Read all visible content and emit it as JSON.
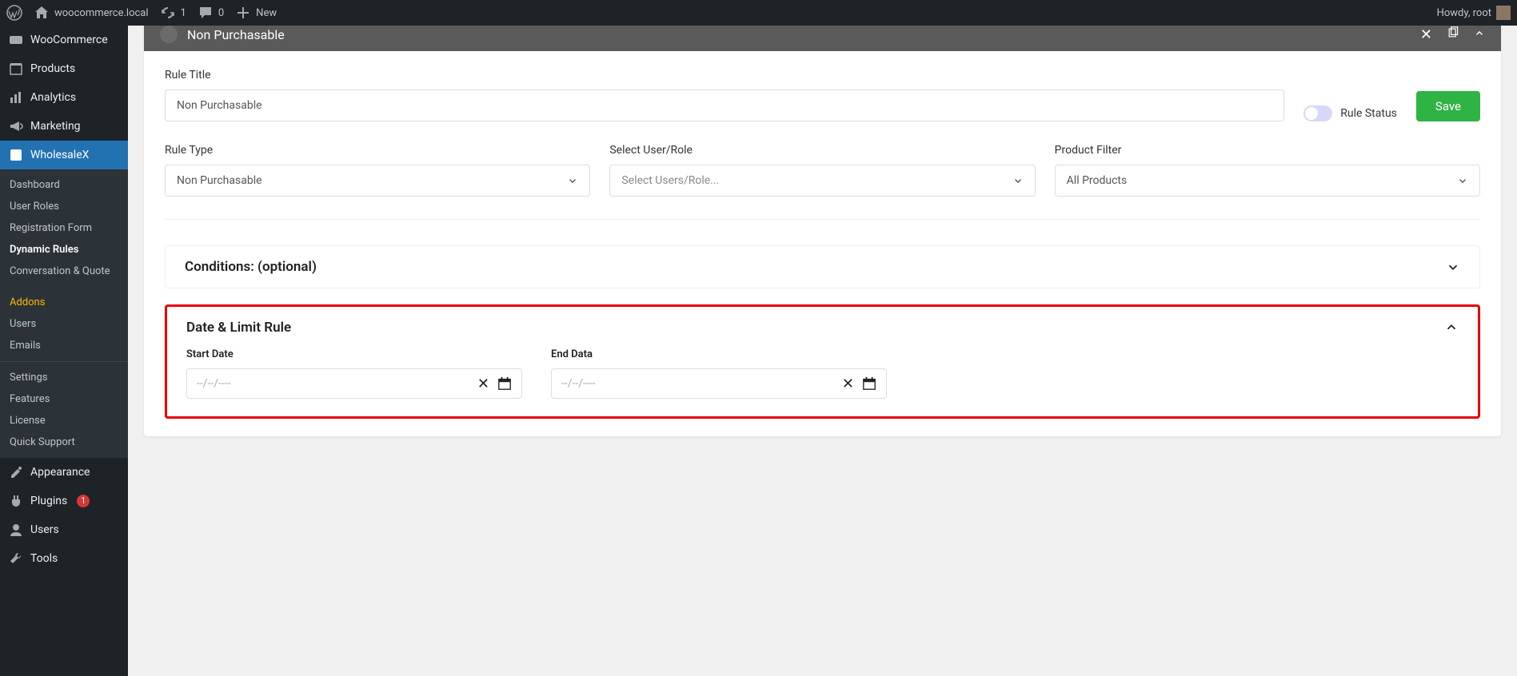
{
  "topbar": {
    "site_name": "woocommerce.local",
    "updates_count": "1",
    "comments_count": "0",
    "new_label": "New",
    "howdy": "Howdy, root"
  },
  "sidebar": {
    "woocommerce": "WooCommerce",
    "products": "Products",
    "analytics": "Analytics",
    "marketing": "Marketing",
    "wholesalex": "WholesaleX",
    "sub": {
      "dashboard": "Dashboard",
      "user_roles": "User Roles",
      "registration_form": "Registration Form",
      "dynamic_rules": "Dynamic Rules",
      "conversation_quote": "Conversation & Quote",
      "addons": "Addons",
      "users": "Users",
      "emails": "Emails",
      "settings": "Settings",
      "features": "Features",
      "license": "License",
      "quick_support": "Quick Support"
    },
    "appearance": "Appearance",
    "plugins": "Plugins",
    "plugins_badge": "1",
    "users_main": "Users",
    "tools": "Tools"
  },
  "panel": {
    "header_title": "Non Purchasable",
    "rule_title_label": "Rule Title",
    "rule_title_value": "Non Purchasable",
    "rule_status_label": "Rule Status",
    "save_label": "Save",
    "rule_type_label": "Rule Type",
    "rule_type_value": "Non Purchasable",
    "select_user_label": "Select User/Role",
    "select_user_placeholder": "Select Users/Role...",
    "product_filter_label": "Product Filter",
    "product_filter_value": "All Products",
    "conditions_title": "Conditions: (optional)",
    "date_limit_title": "Date & Limit Rule",
    "start_date_label": "Start Date",
    "end_date_label": "End Data",
    "date_placeholder": "--/--/----"
  }
}
